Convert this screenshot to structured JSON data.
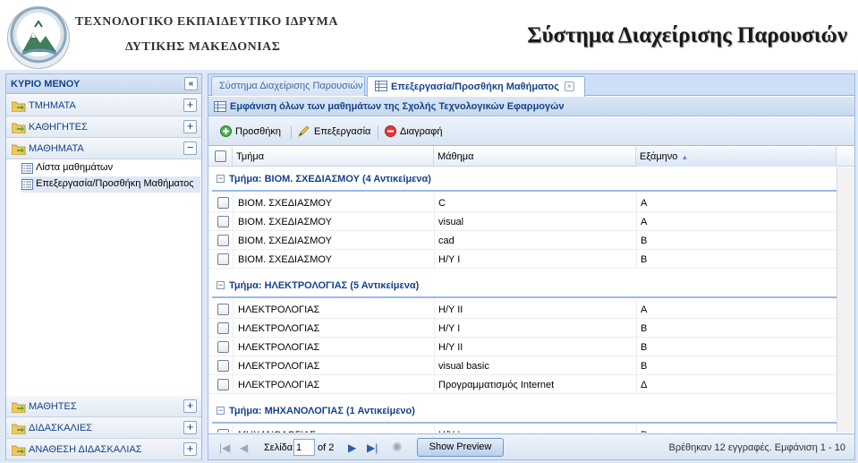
{
  "header": {
    "institution_line1": "ΤΕΧΝΟΛΟΓΙΚΟ ΕΚΠΑΙΔΕΥΤΙΚΟ ΙΔΡΥΜΑ",
    "institution_line2": "ΔΥΤΙΚΗΣ ΜΑΚΕΔΟΝΙΑΣ",
    "app_title": "Σύστημα Διαχείρισης Παρουσιών"
  },
  "menu": {
    "title": "ΚΥΡΙΟ ΜΕΝΟΥ",
    "collapse_icon": "«",
    "sections_top": [
      {
        "label": "ΤΜΗΜΑΤΑ",
        "toggle": "+"
      },
      {
        "label": "ΚΑΘΗΓΗΤΕΣ",
        "toggle": "+"
      },
      {
        "label": "ΜΑΘΗΜΑΤΑ",
        "toggle": "−"
      }
    ],
    "tree_items": [
      {
        "label": "Λίστα μαθημάτων"
      },
      {
        "label": "Επεξεργασία/Προσθήκη Μαθήματος"
      }
    ],
    "sections_bottom": [
      {
        "label": "ΜΑΘΗΤΕΣ",
        "toggle": "+"
      },
      {
        "label": "ΔΙΔΑΣΚΑΛΙΕΣ",
        "toggle": "+"
      },
      {
        "label": "ΑΝΑΘΕΣΗ ΔΙΔΑΣΚΑΛΙΑΣ",
        "toggle": "+"
      }
    ]
  },
  "tabs": [
    {
      "label": "Σύστημα Διαχείρισης Παρουσιών",
      "active": false
    },
    {
      "label": "Επεξεργασία/Προσθήκη Μαθήματος",
      "active": true,
      "close": "×"
    }
  ],
  "grid": {
    "title": "Εμφάνιση όλων των μαθημάτων της Σχολής Τεχνολογικών Εφαρμογών",
    "toolbar": {
      "add": "Προσθήκη",
      "edit": "Επεξεργασία",
      "delete": "Διαγραφή"
    },
    "columns": [
      "Τμήμα",
      "Μάθημα",
      "Εξάμηνο"
    ],
    "sort_indicator": "▲",
    "groups": [
      {
        "title": "Τμήμα: ΒΙΟΜ. ΣΧΕΔΙΑΣΜΟΥ (4 Αντικείμενα)",
        "rows": [
          [
            "ΒΙΟΜ. ΣΧΕΔΙΑΣΜΟΥ",
            "C",
            "Α"
          ],
          [
            "ΒΙΟΜ. ΣΧΕΔΙΑΣΜΟΥ",
            "visual",
            "Α"
          ],
          [
            "ΒΙΟΜ. ΣΧΕΔΙΑΣΜΟΥ",
            "cad",
            "Β"
          ],
          [
            "ΒΙΟΜ. ΣΧΕΔΙΑΣΜΟΥ",
            "Η/Υ Ι",
            "Β"
          ]
        ]
      },
      {
        "title": "Τμήμα: ΗΛΕΚΤΡΟΛΟΓΙΑΣ (5 Αντικείμενα)",
        "rows": [
          [
            "ΗΛΕΚΤΡΟΛΟΓΙΑΣ",
            "Η/Υ ΙΙ",
            "Α"
          ],
          [
            "ΗΛΕΚΤΡΟΛΟΓΙΑΣ",
            "Η/Υ Ι",
            "Β"
          ],
          [
            "ΗΛΕΚΤΡΟΛΟΓΙΑΣ",
            "Η/Υ ΙΙ",
            "Β"
          ],
          [
            "ΗΛΕΚΤΡΟΛΟΓΙΑΣ",
            "visual basic",
            "Β"
          ],
          [
            "ΗΛΕΚΤΡΟΛΟΓΙΑΣ",
            "Προγραμματισμός Internet",
            "Δ"
          ]
        ]
      },
      {
        "title": "Τμήμα: ΜΗΧΑΝΟΛΟΓΙΑΣ (1 Αντικείμενο)",
        "rows": [
          [
            "ΜΗΧΑΝΟΛΟΓΙΑΣ",
            "Η/Υ Ι",
            "Β"
          ]
        ]
      }
    ]
  },
  "pager": {
    "page_label": "Σελίδα",
    "page_value": "1",
    "of_label": "of 2",
    "preview_button": "Show Preview",
    "info": "Βρέθηκαν 12 εγγραφές. Εμφάνιση 1 - 10"
  },
  "colors": {
    "accent": "#15428b",
    "border": "#99bbe8",
    "panel_bg": "#dfe8f6"
  }
}
